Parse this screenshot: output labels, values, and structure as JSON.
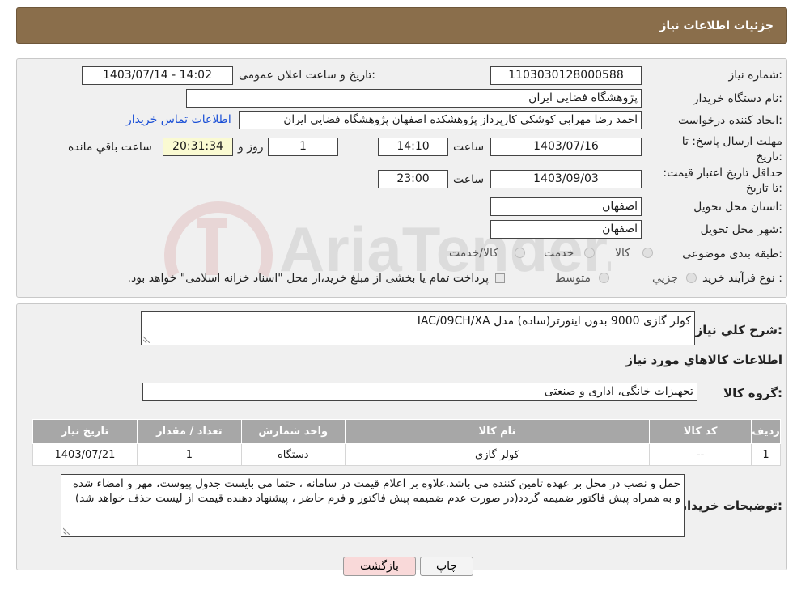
{
  "header": {
    "title": "جزئیات اطلاعات نیاز"
  },
  "form": {
    "need_number_label": "شماره نیاز:",
    "need_number": "1103030128000588",
    "announce_label": "تاریخ و ساعت اعلان عمومی:",
    "announce_value": "1403/07/14 - 14:02",
    "buyer_org_label": "نام دستگاه خریدار:",
    "buyer_org": "پژوهشگاه فضایی ایران",
    "requester_label": "ایجاد کننده درخواست:",
    "requester": "احمد رضا مهرابی کوشکی کارپرداز پژوهشکده اصفهان پژوهشگاه فضایی ایران",
    "contact_link": "اطلاعات تماس خریدار",
    "deadline_label": "مهلت ارسال پاسخ: تا تاریخ:",
    "deadline_date": "1403/07/16",
    "time_label": "ساعت",
    "deadline_time": "14:10",
    "days_value": "1",
    "days_label": "روز و",
    "remaining_time": "20:31:34",
    "remaining_label": "ساعت باقي مانده",
    "validity_label": "حداقل تاریخ اعتبار قیمت: تا تاریخ:",
    "validity_date": "1403/09/03",
    "validity_time": "23:00",
    "province_label": "استان محل تحویل:",
    "province": "اصفهان",
    "city_label": "شهر محل تحویل:",
    "city": "اصفهان",
    "category_label": "طبقه بندی موضوعی:",
    "category_options": [
      "کالا",
      "خدمت",
      "کالا/خدمت"
    ],
    "process_label": "نوع فرآیند خرید :",
    "process_options": [
      "جزيي",
      "متوسط"
    ],
    "payment_note": "پرداخت تمام یا بخشی از مبلغ خرید،از محل \"اسناد خزانه اسلامی\" خواهد بود."
  },
  "summary": {
    "description_label": "شرح کلي نياز:",
    "description": "کولر گازی 9000  بدون اینورتر(ساده) مدل IAC/09CH/XA",
    "goods_info_title": "اطلاعات کالاهاي مورد نياز",
    "goods_group_label": "گروه کالا:",
    "goods_group": "تجهیزات خانگی، اداری و صنعتی"
  },
  "table": {
    "headers": [
      "رديف",
      "کد کالا",
      "نام کالا",
      "واحد شمارش",
      "تعداد / مقدار",
      "تاريخ نياز"
    ],
    "rows": [
      [
        "1",
        "--",
        "کولر گازی",
        "دستگاه",
        "1",
        "1403/07/21"
      ]
    ]
  },
  "buyer_notes": {
    "label": "توضیحات خریدار:",
    "text": "حمل و نصب در محل بر عهده تامین کننده می باشد.علاوه بر اعلام قیمت در سامانه ، حتما می بایست جدول پیوست، مهر و امضاء شده و به همراه پیش فاکتور ضمیمه گردد(در صورت عدم ضمیمه پیش فاکتور و فرم حاضر ، پیشنهاد دهنده قیمت از لیست حذف خواهد شد)"
  },
  "buttons": {
    "print": "چاپ",
    "back": "بازگشت"
  },
  "watermark": {
    "text": "AriaTender.neT"
  },
  "colors": {
    "header": "#8a6e4b",
    "link": "#1a4fd6",
    "back_button": "#f9d9d9",
    "table_header": "#a7a7a7"
  }
}
